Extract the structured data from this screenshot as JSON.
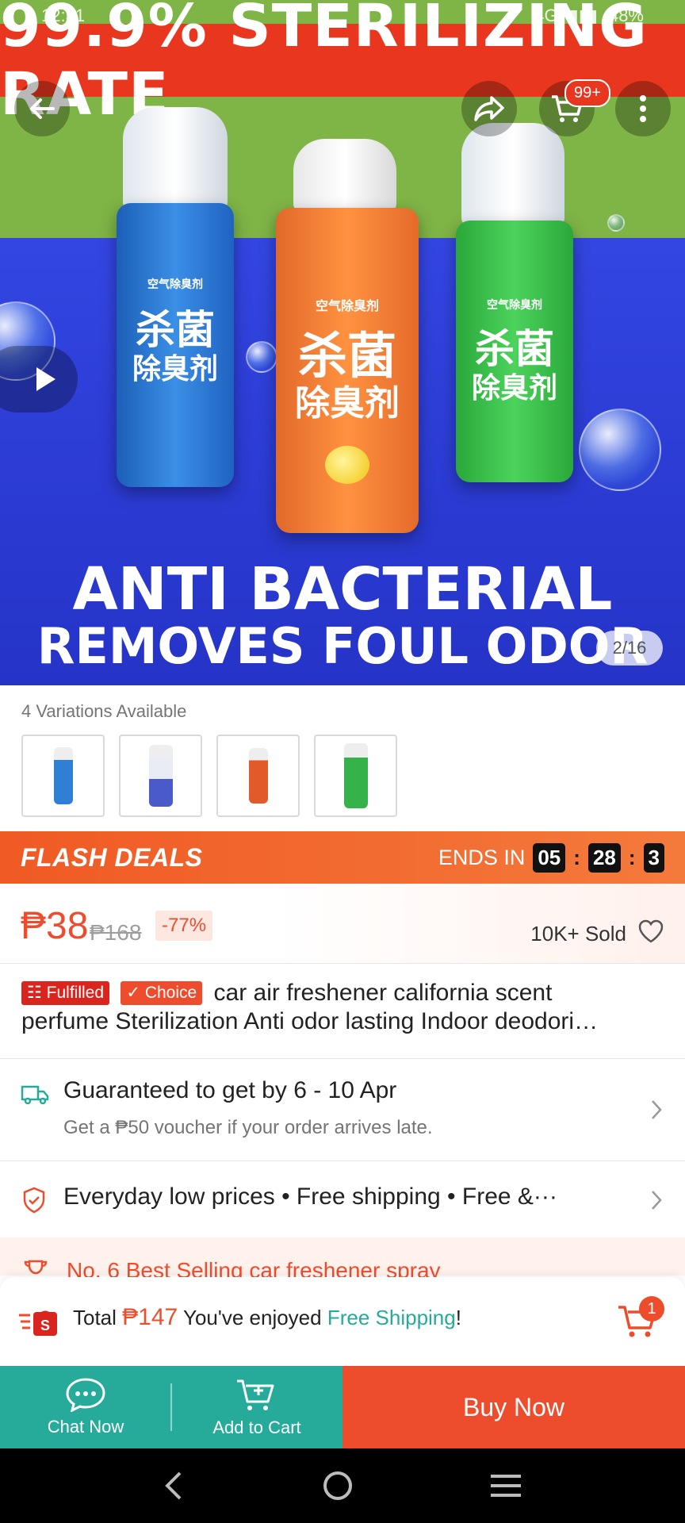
{
  "status_bar": {
    "time": "12:31",
    "network": "4G",
    "battery": "48%"
  },
  "hero": {
    "banner_top": "99.9% STERILIZING RATE",
    "headline_1": "ANTI BACTERIAL",
    "headline_2": "REMOVES FOUL ODOR",
    "counter": "2/16",
    "cart_badge": "99+",
    "can_label_cn_1": "杀菌",
    "can_label_cn_2": "除臭剂",
    "can_sub_cn": "空气除臭剂"
  },
  "variations": {
    "label": "4 Variations Available",
    "thumb_colors": [
      "#2f7fd6",
      "#e9ecf5",
      "#e2592a",
      "#35b24a"
    ]
  },
  "flash_deals": {
    "title": "FLASH DEALS",
    "ends_in": "ENDS IN",
    "timer": [
      "05",
      "28",
      "3"
    ]
  },
  "price": {
    "current": "₱38",
    "original": "₱168",
    "discount": "-77%",
    "sold": "10K+ Sold"
  },
  "product": {
    "tag_fulfilled": "Fulfilled",
    "tag_choice": "Choice",
    "title_1": "car air freshener california scent",
    "title_2": "perfume Sterilization Anti odor lasting Indoor deodori…"
  },
  "delivery": {
    "main": "Guaranteed to get by 6 - 10 Apr",
    "sub": "Get a ₱50 voucher if your order arrives late."
  },
  "guarantee": {
    "text": "Everyday low prices  •  Free shipping  •  Free &···"
  },
  "best_selling": {
    "text": "No. 6 Best Selling car freshener spray"
  },
  "total_bar": {
    "label": "Total",
    "amount": "₱147",
    "enjoyed": "You've enjoyed",
    "free_shipping": "Free Shipping",
    "exclaim": "!",
    "cart_count": "1"
  },
  "actions": {
    "chat": "Chat Now",
    "add_to_cart": "Add to Cart",
    "buy_now": "Buy Now"
  },
  "colors": {
    "accent": "#ee4d2d",
    "teal": "#26aa99"
  }
}
